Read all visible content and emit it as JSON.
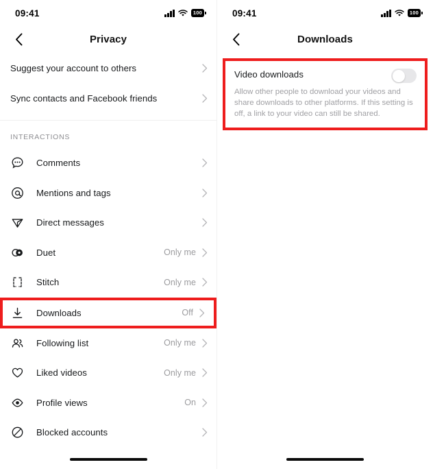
{
  "status_bar": {
    "time": "09:41",
    "battery_level": "100",
    "signal_icon": "cellular-signal-icon",
    "wifi_icon": "wifi-icon",
    "battery_icon": "battery-icon"
  },
  "accent_red": "#ee1d1d",
  "left_screen": {
    "title": "Privacy",
    "back_icon": "chevron-left-icon",
    "top_items": [
      {
        "label": "Suggest your account to others",
        "value": "",
        "icon": "",
        "chevron": "chevron-right-icon"
      },
      {
        "label": "Sync contacts and Facebook friends",
        "value": "",
        "icon": "",
        "chevron": "chevron-right-icon"
      }
    ],
    "section_header": "INTERACTIONS",
    "items": [
      {
        "label": "Comments",
        "value": "",
        "icon": "comment-bubble-icon",
        "highlighted": false
      },
      {
        "label": "Mentions and tags",
        "value": "",
        "icon": "at-sign-icon",
        "highlighted": false
      },
      {
        "label": "Direct messages",
        "value": "",
        "icon": "paper-plane-icon",
        "highlighted": false
      },
      {
        "label": "Duet",
        "value": "Only me",
        "icon": "duet-icon",
        "highlighted": false
      },
      {
        "label": "Stitch",
        "value": "Only me",
        "icon": "stitch-icon",
        "highlighted": false
      },
      {
        "label": "Downloads",
        "value": "Off",
        "icon": "download-icon",
        "highlighted": true
      },
      {
        "label": "Following list",
        "value": "Only me",
        "icon": "people-icon",
        "highlighted": false
      },
      {
        "label": "Liked videos",
        "value": "Only me",
        "icon": "heart-icon",
        "highlighted": false
      },
      {
        "label": "Profile views",
        "value": "On",
        "icon": "eye-icon",
        "highlighted": false
      },
      {
        "label": "Blocked accounts",
        "value": "",
        "icon": "block-circle-icon",
        "highlighted": false
      }
    ]
  },
  "right_screen": {
    "title": "Downloads",
    "back_icon": "chevron-left-icon",
    "card": {
      "title": "Video downloads",
      "description": "Allow other people to download your videos and share downloads to other platforms. If this setting is off, a link to your video can still be shared.",
      "toggle_state": "off",
      "highlighted": true
    }
  }
}
